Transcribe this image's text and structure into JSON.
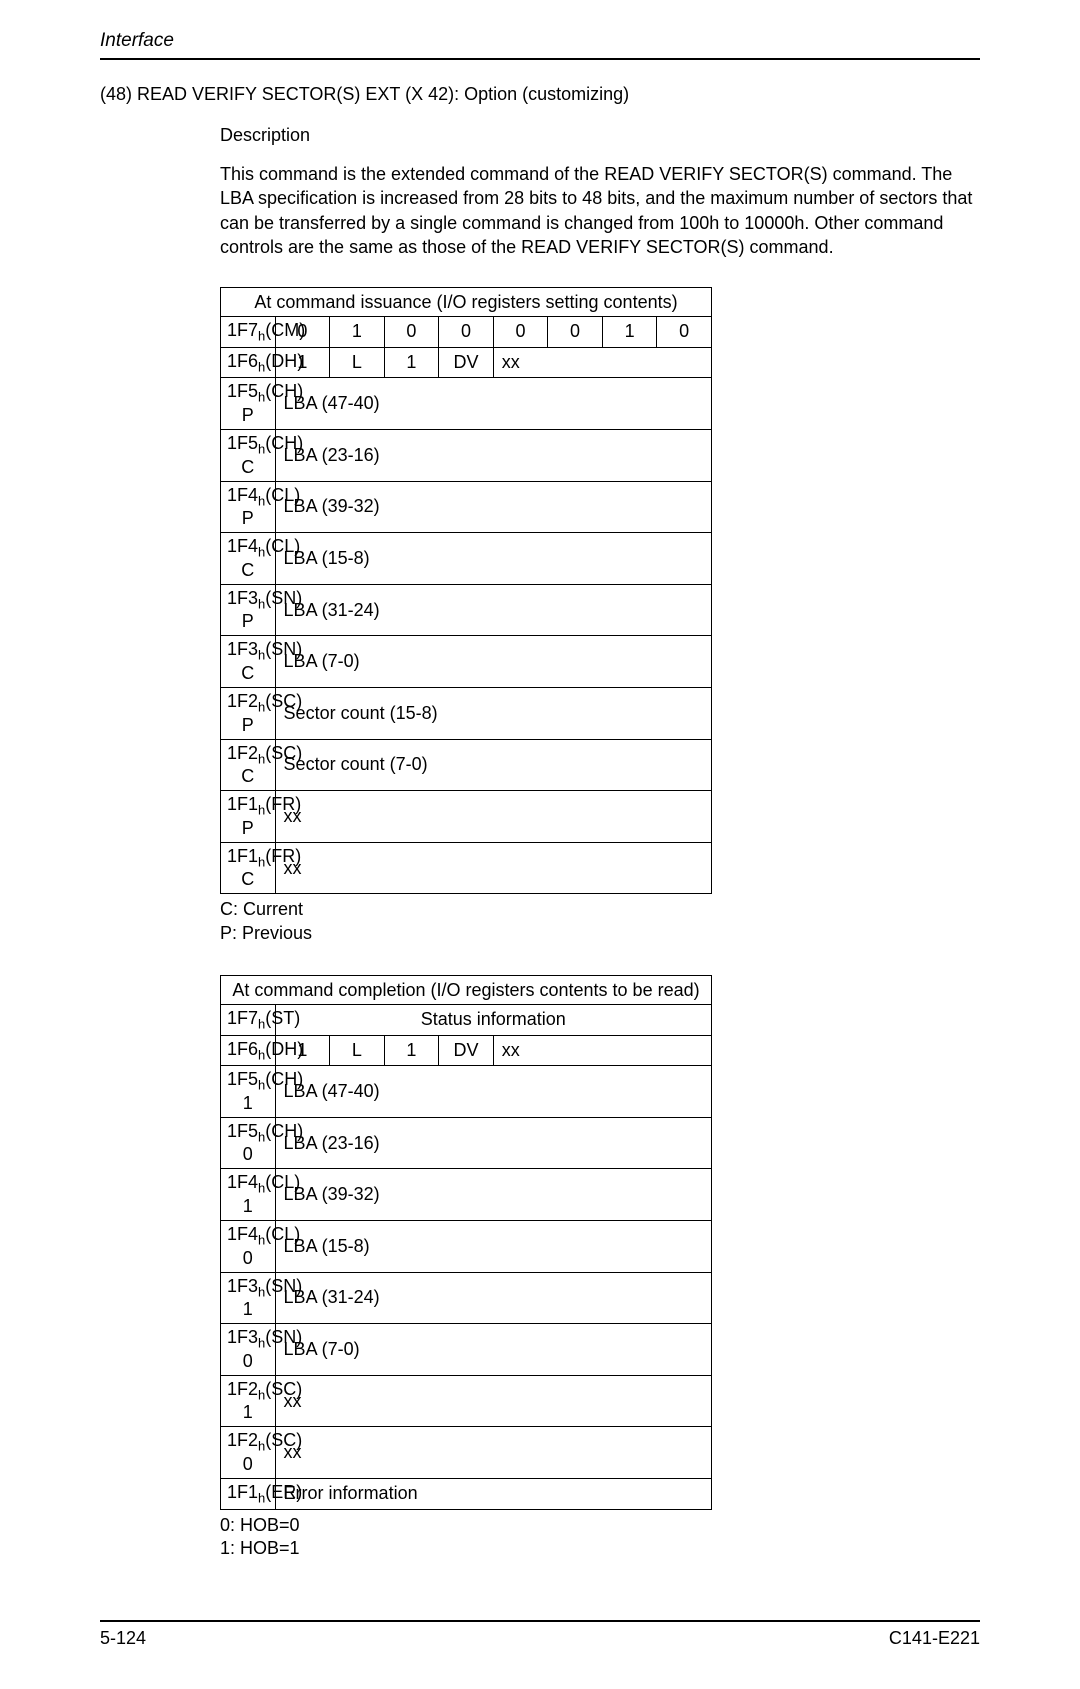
{
  "header": {
    "section": "Interface"
  },
  "title": "(48)  READ VERIFY SECTOR(S) EXT (X 42):  Option (customizing)",
  "description": {
    "heading": "Description",
    "body": "This command is the extended command of the READ VERIFY SECTOR(S) command.  The LBA specification is increased from 28 bits to 48 bits, and the maximum number of sectors that can be transferred by a single command is changed from 100h to 10000h.  Other command controls are the same as those of the READ VERIFY SECTOR(S) command."
  },
  "table1": {
    "title": "At command issuance (I/O registers setting contents)",
    "row_cm": {
      "reg": "1F7",
      "reg_suffix": "(CM)",
      "bits": [
        "0",
        "1",
        "0",
        "0",
        "0",
        "0",
        "1",
        "0"
      ]
    },
    "row_dh": {
      "reg": "1F6",
      "reg_suffix": "(DH)",
      "b0": "1",
      "b1": "L",
      "b2": "1",
      "b3": "DV",
      "rest": "xx"
    },
    "rows": [
      {
        "reg": "1F5",
        "reg_suffix": "(CH) P",
        "val": "LBA (47-40)"
      },
      {
        "reg": "1F5",
        "reg_suffix": "(CH) C",
        "val": "LBA (23-16)"
      },
      {
        "reg": "1F4",
        "reg_suffix": "(CL) P",
        "val": "LBA (39-32)"
      },
      {
        "reg": "1F4",
        "reg_suffix": "(CL) C",
        "val": "LBA (15-8)"
      },
      {
        "reg": "1F3",
        "reg_suffix": "(SN) P",
        "val": "LBA (31-24)"
      },
      {
        "reg": "1F3",
        "reg_suffix": "(SN) C",
        "val": "LBA (7-0)"
      },
      {
        "reg": "1F2",
        "reg_suffix": "(SC) P",
        "val": "Sector count (15-8)"
      },
      {
        "reg": "1F2",
        "reg_suffix": "(SC) C",
        "val": "Sector count (7-0)"
      },
      {
        "reg": "1F1",
        "reg_suffix": "(FR) P",
        "val": "xx"
      },
      {
        "reg": "1F1",
        "reg_suffix": "(FR) C",
        "val": "xx"
      }
    ],
    "notes": {
      "c": "C:  Current",
      "p": "P:  Previous"
    }
  },
  "table2": {
    "title": "At command completion (I/O registers contents to be read)",
    "row_st": {
      "reg": "1F7",
      "reg_suffix": "(ST)",
      "val": "Status information"
    },
    "row_dh": {
      "reg": "1F6",
      "reg_suffix": "(DH)",
      "b0": "1",
      "b1": "L",
      "b2": "1",
      "b3": "DV",
      "rest": "xx"
    },
    "rows": [
      {
        "reg": "1F5",
        "reg_suffix": "(CH) 1",
        "val": "LBA (47-40)"
      },
      {
        "reg": "1F5",
        "reg_suffix": "(CH) 0",
        "val": "LBA (23-16)"
      },
      {
        "reg": "1F4",
        "reg_suffix": "(CL) 1",
        "val": "LBA (39-32)"
      },
      {
        "reg": "1F4",
        "reg_suffix": "(CL) 0",
        "val": "LBA (15-8)"
      },
      {
        "reg": "1F3",
        "reg_suffix": "(SN) 1",
        "val": "LBA (31-24)"
      },
      {
        "reg": "1F3",
        "reg_suffix": "(SN) 0",
        "val": "LBA (7-0)"
      },
      {
        "reg": "1F2",
        "reg_suffix": "(SC) 1",
        "val": "xx"
      },
      {
        "reg": "1F2",
        "reg_suffix": "(SC) 0",
        "val": "xx"
      },
      {
        "reg": "1F1",
        "reg_suffix": "(ER)",
        "val": "Error information"
      }
    ],
    "notes": {
      "n0": "0:  HOB=0",
      "n1": "1:  HOB=1"
    }
  },
  "footer": {
    "left": "5-124",
    "right": "C141-E221"
  }
}
